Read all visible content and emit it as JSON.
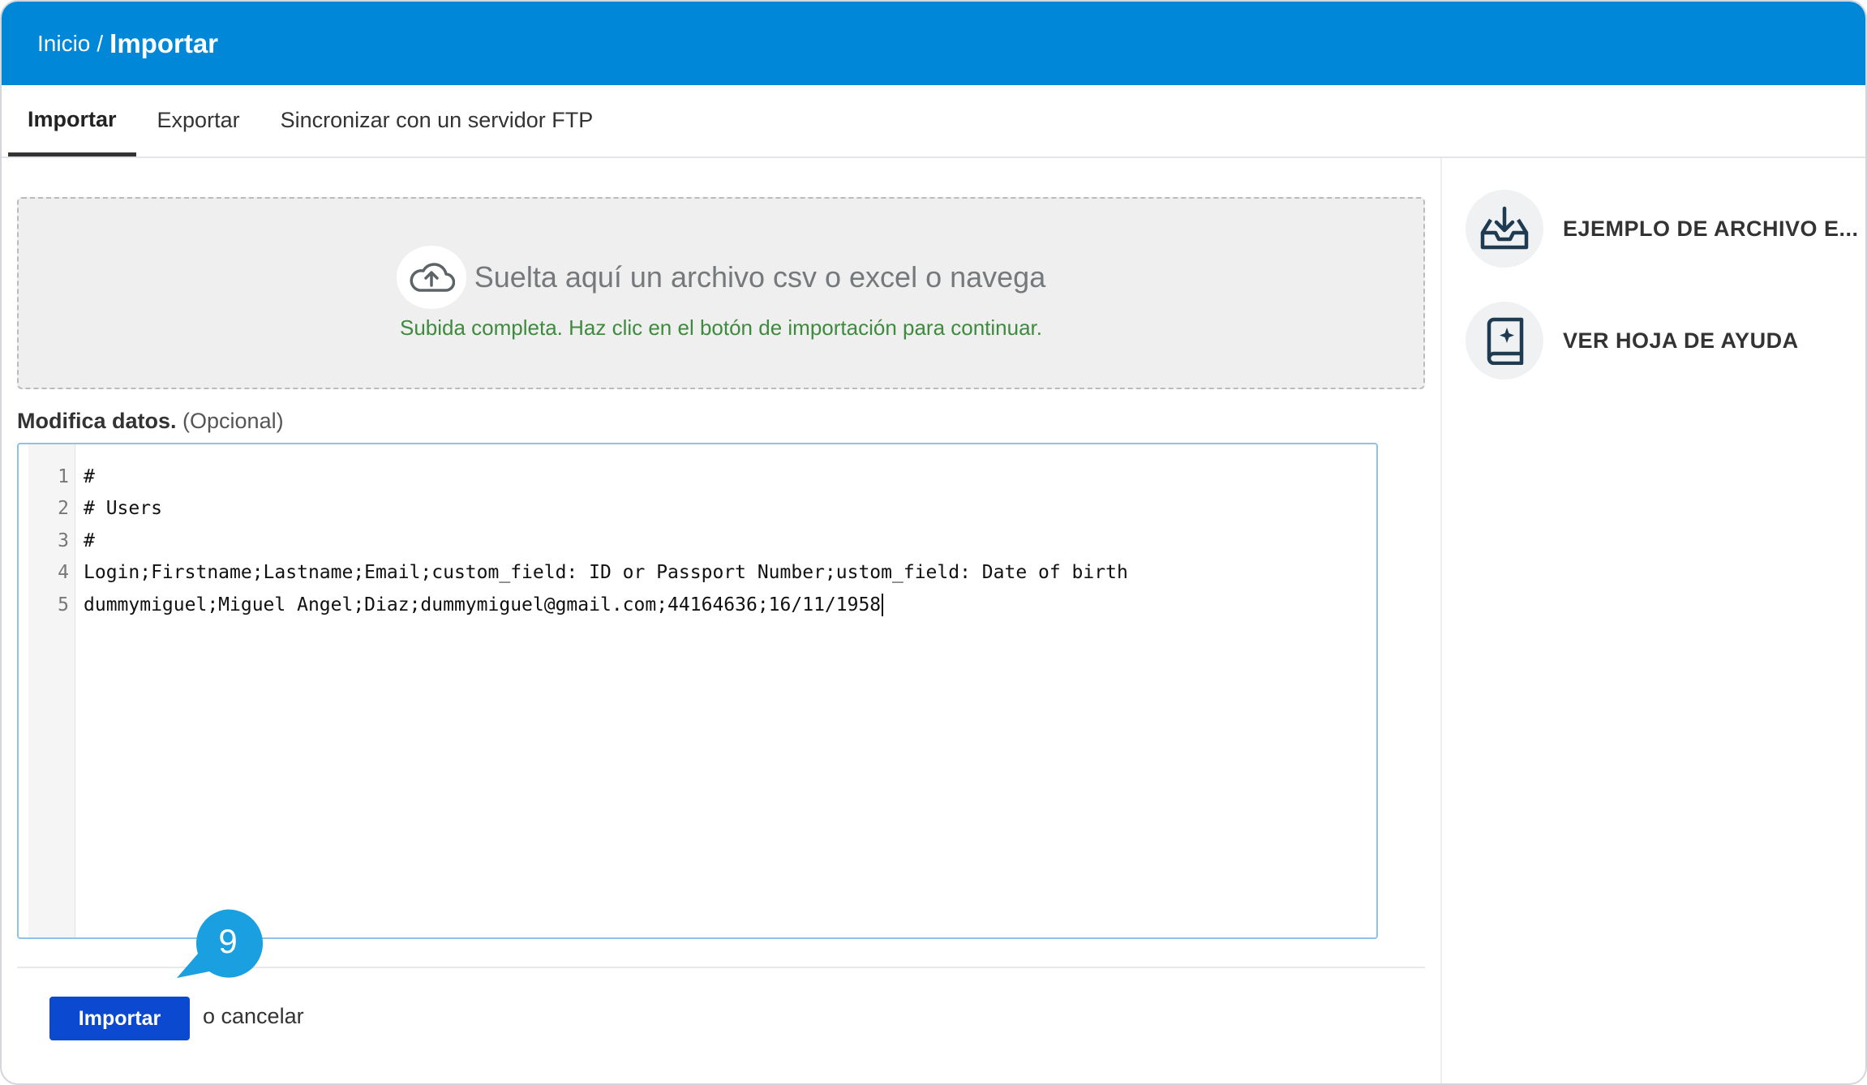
{
  "header": {
    "breadcrumb_root": "Inicio",
    "separator": "/",
    "current": "Importar"
  },
  "tabs": [
    {
      "label": "Importar",
      "active": true
    },
    {
      "label": "Exportar",
      "active": false
    },
    {
      "label": "Sincronizar con un servidor FTP",
      "active": false
    }
  ],
  "dropzone": {
    "prompt": "Suelta aquí un archivo csv o excel o navega",
    "status": "Subida completa. Haz clic en el botón de importación para continuar.",
    "icon": "cloud-upload-icon"
  },
  "editor": {
    "label_strong": "Modifica datos.",
    "label_optional": "(Opcional)",
    "lines": [
      "#",
      "# Users",
      "#",
      "Login;Firstname;Lastname;Email;custom_field: ID or Passport Number;ustom_field: Date of birth",
      "dummymiguel;Miguel Angel;Diaz;dummymiguel@gmail.com;44164636;16/11/1958"
    ]
  },
  "actions": {
    "import_label": "Importar",
    "cancel_label": "o cancelar"
  },
  "callout": {
    "step": "9"
  },
  "sidebar": {
    "items": [
      {
        "label": "EJEMPLO DE ARCHIVO E...",
        "icon": "download-tray-icon"
      },
      {
        "label": "VER HOJA DE AYUDA",
        "icon": "help-book-icon"
      }
    ]
  },
  "colors": {
    "header": "#0087d7",
    "primary_button": "#0b49d1",
    "success_text": "#3e8a3e",
    "callout": "#1a9fe0",
    "icon": "#1f3b52"
  }
}
